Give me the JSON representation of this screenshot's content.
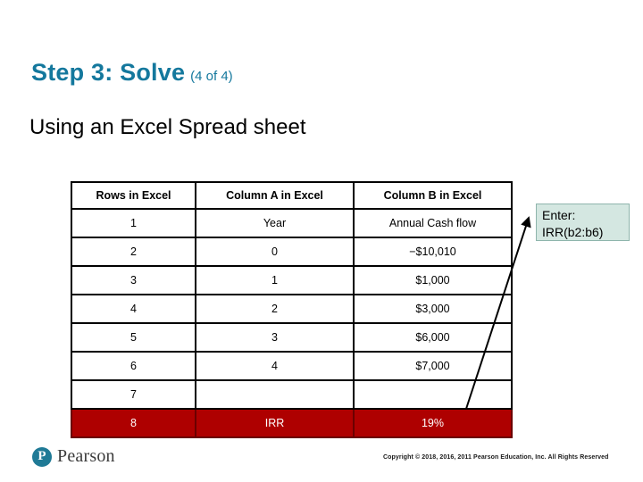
{
  "slide": {
    "title_main": "Step 3: Solve",
    "title_suffix": "(4 of 4)",
    "subtitle": "Using an Excel Spread sheet",
    "accent_color": "#14789d",
    "highlight_row_color": "#AE0000",
    "callout_bg_color": "#D4E7E1"
  },
  "table": {
    "headers": [
      "Rows in Excel",
      "Column A in Excel",
      "Column B in Excel"
    ],
    "rows": [
      {
        "cells": [
          "1",
          "Year",
          "Annual Cash flow"
        ],
        "highlight": false
      },
      {
        "cells": [
          "2",
          "0",
          "−$10,010"
        ],
        "highlight": false
      },
      {
        "cells": [
          "3",
          "1",
          "$1,000"
        ],
        "highlight": false
      },
      {
        "cells": [
          "4",
          "2",
          "$3,000"
        ],
        "highlight": false
      },
      {
        "cells": [
          "5",
          "3",
          "$6,000"
        ],
        "highlight": false
      },
      {
        "cells": [
          "6",
          "4",
          "$7,000"
        ],
        "highlight": false
      },
      {
        "cells": [
          "7",
          "",
          ""
        ],
        "highlight": false
      },
      {
        "cells": [
          "8",
          "IRR",
          "19%"
        ],
        "highlight": true
      }
    ]
  },
  "callout": {
    "line1": "Enter:",
    "line2": "IRR(b2:b6)"
  },
  "footer": {
    "logo_text": "Pearson",
    "logo_mark": "pearson-p-icon",
    "copyright": "Copyright © 2018, 2016, 2011 Pearson Education, Inc. All Rights Reserved"
  }
}
